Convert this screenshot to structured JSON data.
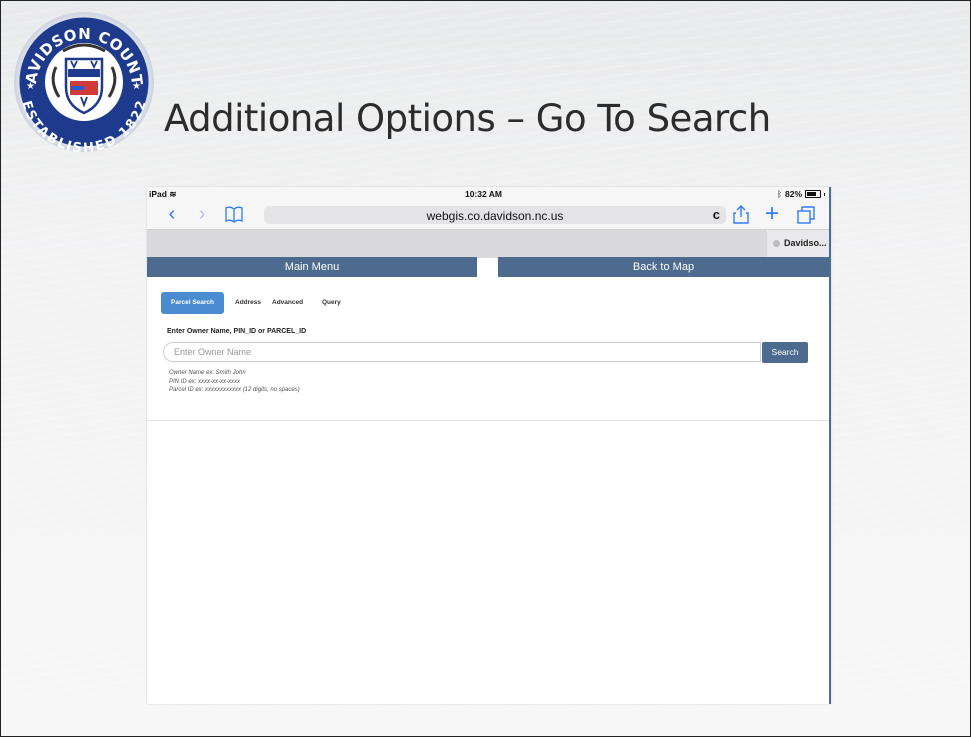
{
  "slide": {
    "title": "Additional Options – Go To Search"
  },
  "seal": {
    "top_text": "DAVIDSON COUNTY",
    "bottom_text": "ESTABLISHED 1822"
  },
  "status_bar": {
    "device": "iPad",
    "time": "10:32 AM",
    "battery": "82%"
  },
  "browser": {
    "url": "webgis.co.davidson.nc.us",
    "tab_title": "Davidso..."
  },
  "nav": {
    "main_menu": "Main Menu",
    "back_to_map": "Back to Map"
  },
  "search_tabs": [
    {
      "label": "Parcel Search",
      "active": true
    },
    {
      "label": "Address",
      "active": false
    },
    {
      "label": "Advanced",
      "active": false
    },
    {
      "label": "Query",
      "active": false
    }
  ],
  "search": {
    "field_label": "Enter Owner Name, PIN_ID or PARCEL_ID",
    "placeholder": "Enter Owner Name",
    "value": "",
    "button_label": "Search",
    "hints": [
      "Owner Name ex: Smith John",
      "PIN ID ex: xxxx-xx-xx-xxxx",
      "Parcel ID ex: xxxxxxxxxxxx (12 digits, no spaces)"
    ]
  },
  "colors": {
    "nav_button": "#4d6b8e",
    "active_tab": "#4b8cd0",
    "ios_blue": "#2f7bf5"
  }
}
